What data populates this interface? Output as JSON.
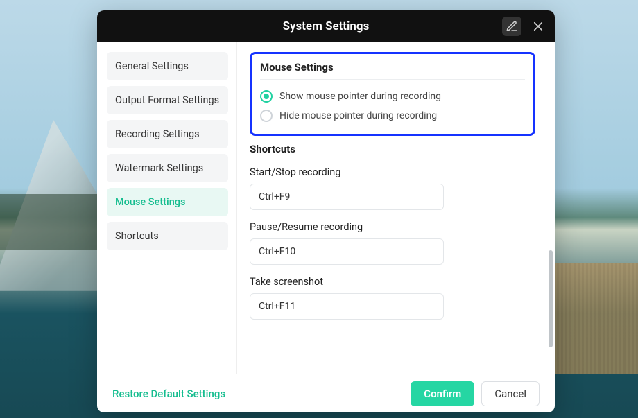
{
  "title": "System Settings",
  "sidebar": {
    "items": [
      {
        "label": "General Settings"
      },
      {
        "label": "Output Format Settings"
      },
      {
        "label": "Recording Settings"
      },
      {
        "label": "Watermark Settings"
      },
      {
        "label": "Mouse Settings"
      },
      {
        "label": "Shortcuts"
      }
    ],
    "active_index": 4
  },
  "mouse_section": {
    "title": "Mouse Settings",
    "option_show": "Show mouse pointer during recording",
    "option_hide": "Hide mouse pointer during recording",
    "selected": "show"
  },
  "shortcuts_section": {
    "title": "Shortcuts",
    "start_stop_label": "Start/Stop recording",
    "start_stop_value": "Ctrl+F9",
    "pause_resume_label": "Pause/Resume recording",
    "pause_resume_value": "Ctrl+F10",
    "screenshot_label": "Take screenshot",
    "screenshot_value": "Ctrl+F11"
  },
  "footer": {
    "restore": "Restore Default Settings",
    "confirm": "Confirm",
    "cancel": "Cancel"
  },
  "colors": {
    "accent": "#1fd1a1",
    "highlight_border": "#1532ff"
  }
}
